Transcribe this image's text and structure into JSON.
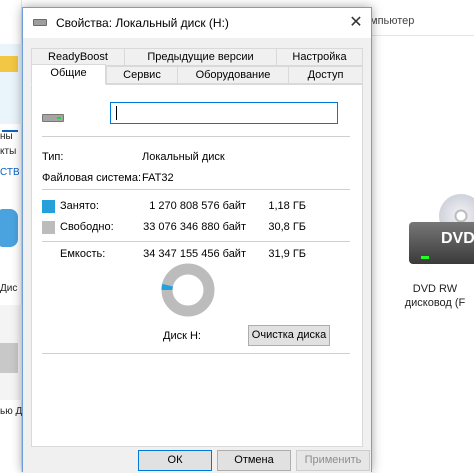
{
  "background": {
    "breadcrumb": "мпьютер",
    "left_labels": [
      "ны",
      "кты",
      "СТВ",
      "Дис",
      "ью Дис"
    ],
    "drive_icon_text": "DVD",
    "dvd_label_line1": "DVD RW",
    "dvd_label_line2": "дисковод (F"
  },
  "dialog": {
    "title": "Свойства: Локальный диск (H:)",
    "close_glyph": "✕",
    "tabs_row1": [
      "ReadyBoost",
      "Предыдущие версии",
      "Настройка"
    ],
    "tabs_row2": [
      "Общие",
      "Сервис",
      "Оборудование",
      "Доступ"
    ],
    "active_tab": "Общие",
    "name_value": "",
    "type_label": "Тип:",
    "type_value": "Локальный диск",
    "fs_label": "Файловая система:",
    "fs_value": "FAT32",
    "used_label": "Занято:",
    "used_bytes": "1 270 808 576 байт",
    "used_gb": "1,18 ГБ",
    "free_label": "Свободно:",
    "free_bytes": "33 076 346 880 байт",
    "free_gb": "30,8 ГБ",
    "capacity_label": "Емкость:",
    "capacity_bytes": "34 347 155 456 байт",
    "capacity_gb": "31,9 ГБ",
    "disk_label": "Диск H:",
    "cleanup_button": "Очистка диска",
    "used_fraction": 0.037,
    "colors": {
      "used": "#26a0da",
      "free": "#bcbcbc"
    },
    "ok_button": "ОК",
    "cancel_button": "Отмена",
    "apply_button": "Применить"
  }
}
